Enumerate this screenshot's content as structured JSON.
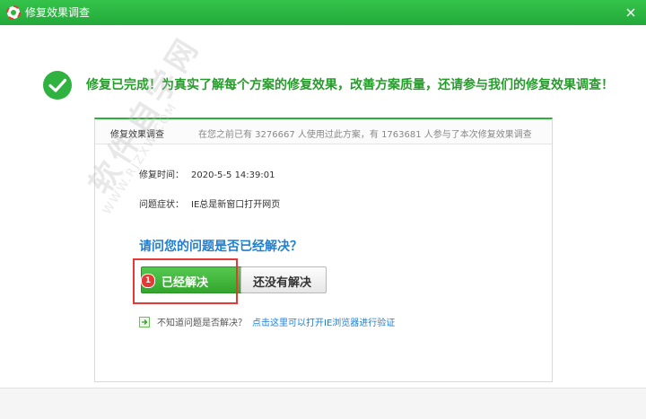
{
  "window": {
    "title": "修复效果调查",
    "close_icon": "close-icon",
    "app_icon": "lifebuoy-icon",
    "title_bar_color": "#2db53f"
  },
  "headline": {
    "icon": "check-circle-icon",
    "text": "修复已完成！为真实了解每个方案的修复效果，改善方案质量，还请参与我们的修复效果调查！"
  },
  "panel": {
    "title": "修复效果调查",
    "stats": "在您之前已有 3276667 人使用过此方案，有 1763681 人参与了本次修复效果调查",
    "repair_time_label": "修复时间：",
    "repair_time_value": "2020-5-5 14:39:01",
    "symptom_label": "问题症状：",
    "symptom_value": "IE总是新窗口打开网页",
    "question": "请问您的问题是否已经解决？",
    "yes_button": "已经解决",
    "no_button": "还没有解决",
    "step_badge": "1",
    "verify_question": "不知道问题是否解决？",
    "verify_link": "点击这里可以打开IE浏览器进行验证"
  },
  "watermark": {
    "text": "软件自学网",
    "sub": "WWW.RJZXW.COM"
  },
  "colors": {
    "accent_green": "#279c2c",
    "link_blue": "#1f7fd1",
    "highlight_red": "#e53935"
  }
}
